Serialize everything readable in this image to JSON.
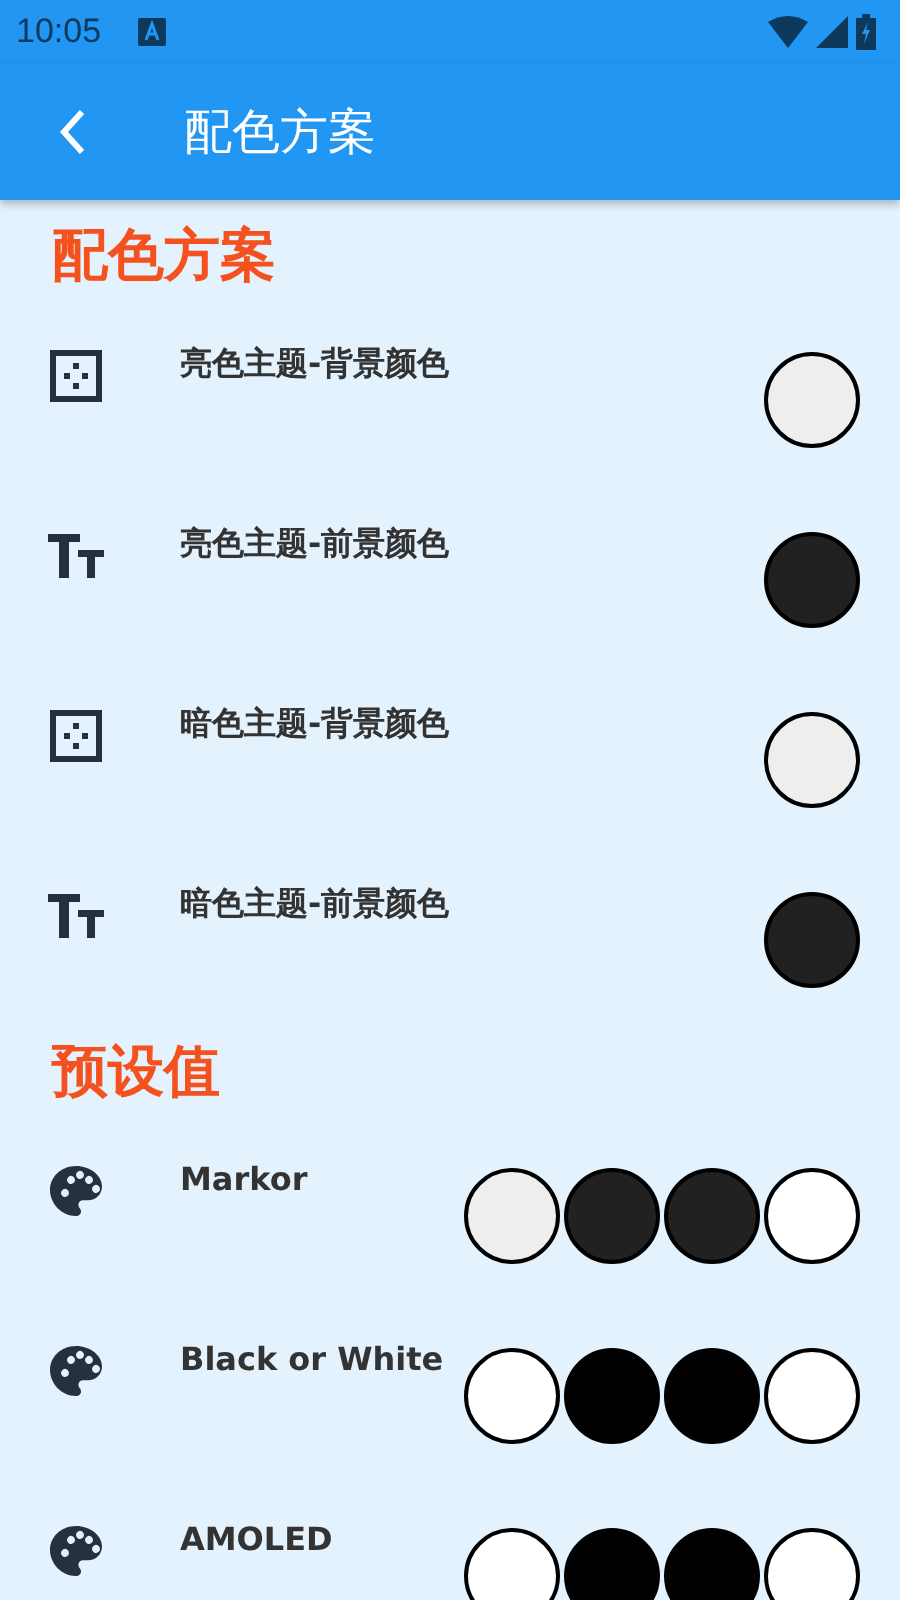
{
  "status_bar": {
    "time": "10:05"
  },
  "app_bar": {
    "title": "配色方案"
  },
  "sections": [
    {
      "title": "配色方案",
      "items": [
        {
          "kind": "background",
          "label": "亮色主题-背景颜色",
          "colors": [
            {
              "color": "#eeeeee"
            }
          ]
        },
        {
          "kind": "foreground",
          "label": "亮色主题-前景颜色",
          "colors": [
            {
              "color": "#212121"
            }
          ]
        },
        {
          "kind": "background",
          "label": "暗色主题-背景颜色",
          "colors": [
            {
              "color": "#eeeeee"
            }
          ]
        },
        {
          "kind": "foreground",
          "label": "暗色主题-前景颜色",
          "colors": [
            {
              "color": "#212121"
            }
          ]
        }
      ]
    },
    {
      "title": "预设值",
      "items": [
        {
          "kind": "preset",
          "label": "Markor",
          "colors": [
            {
              "color": "#eeeeee"
            },
            {
              "color": "#212121"
            },
            {
              "color": "#212121"
            },
            {
              "color": "#ffffff"
            }
          ]
        },
        {
          "kind": "preset",
          "label": "Black or White",
          "colors": [
            {
              "color": "#ffffff"
            },
            {
              "color": "#000000"
            },
            {
              "color": "#000000"
            },
            {
              "color": "#ffffff"
            }
          ]
        },
        {
          "kind": "preset",
          "label": "AMOLED",
          "colors": [
            {
              "color": "#ffffff"
            },
            {
              "color": "#000000"
            },
            {
              "color": "#000000"
            },
            {
              "color": "#ffffff"
            }
          ]
        }
      ]
    }
  ]
}
